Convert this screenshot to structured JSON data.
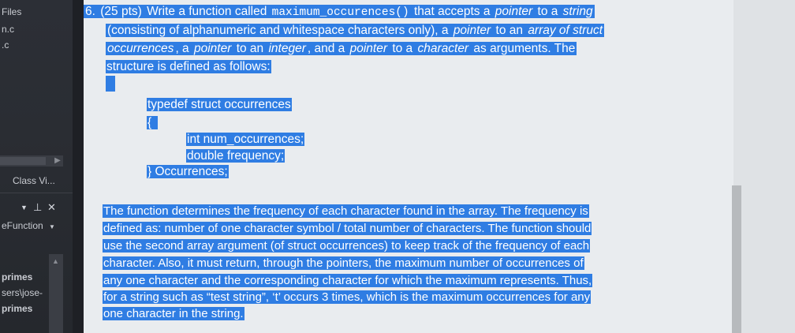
{
  "sidebar": {
    "files_label": "Files",
    "file1": "n.c",
    "file2": ".c",
    "class_view_label": "Class Vi...",
    "pin_icon": "pin-icon",
    "close_icon": "close-icon",
    "function_label": "eFunction",
    "tree": [
      "primes",
      "sers\\jose-",
      "primes"
    ]
  },
  "document": {
    "q_number": "6.",
    "q_points": "(25 pts)",
    "para1": [
      "Write a function called ",
      "maximum_occurences()",
      " that accepts a ",
      "pointer",
      " to a ",
      "string",
      "(consisting of alphanumeric and whitespace characters only), a ",
      "pointer",
      " to an ",
      "array of struct",
      "occurrences",
      ", a ",
      "pointer",
      " to an ",
      "integer",
      ", and a ",
      "pointer",
      " to a ",
      "character",
      " as arguments. The",
      "structure is defined as follows:"
    ],
    "code": [
      "typedef struct occurrences",
      "{",
      "int num_occurrences;",
      "double frequency;",
      "} Occurrences;"
    ],
    "para2": [
      "The function determines the frequency of each character found in the array. The frequency is",
      "defined as: number of one character symbol / total number of characters. The function should",
      "use the second array argument (of struct occurrences) to keep track of the frequency of each",
      "character. Also, it must return, through the pointers, the maximum number of occurrences of",
      "any one character and the corresponding character for which the maximum represents. Thus,",
      "for a string such as “test string”, ‘t’ occurs 3 times, which is the maximum occurrences for any",
      "one character in the string."
    ]
  },
  "colors": {
    "highlight": "#2f7de3",
    "page": "#e9ecef",
    "panel": "#2c2f36"
  }
}
